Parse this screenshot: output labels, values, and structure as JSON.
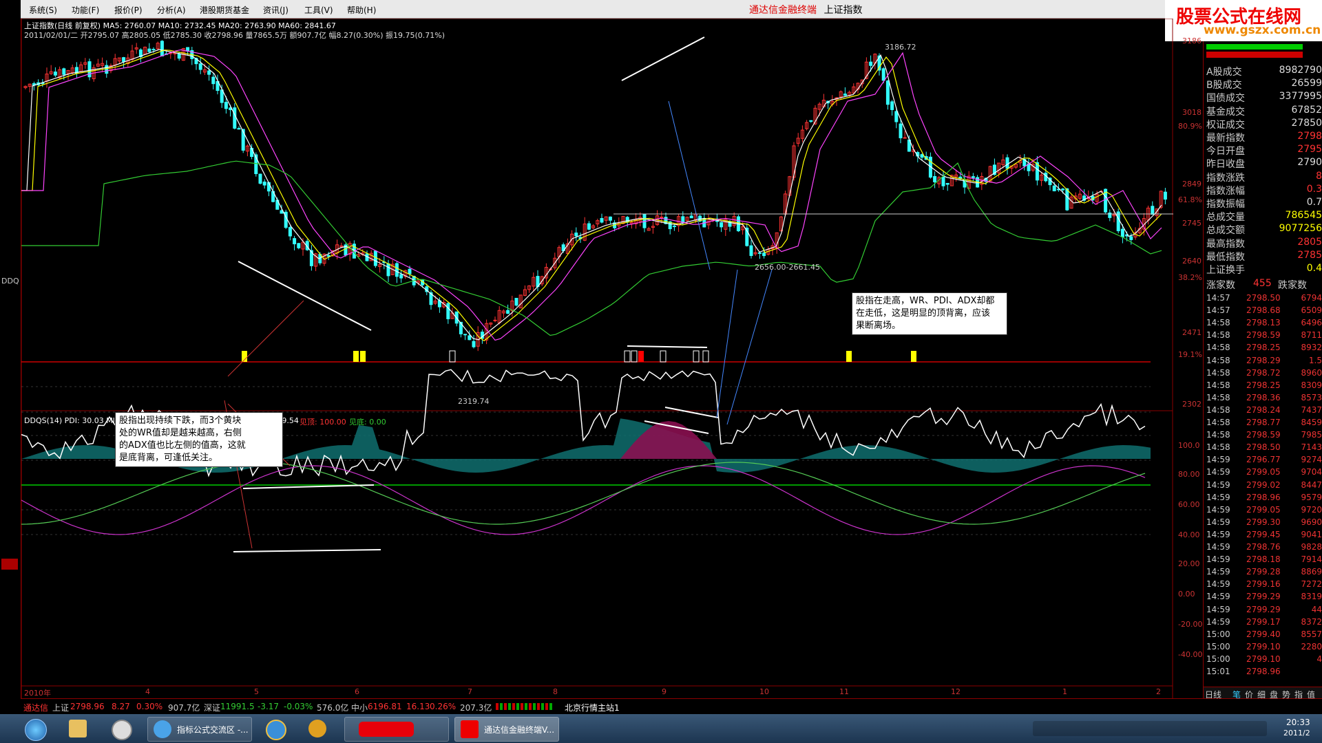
{
  "menu": {
    "items": [
      "系统(S)",
      "功能(F)",
      "报价(P)",
      "分析(A)",
      "港股期货基金",
      "资讯(J)",
      "工具(V)",
      "帮助(H)"
    ],
    "app_title": "通达信金融终端",
    "instrument": "上证指数"
  },
  "watermark": {
    "title": "股票公式在线网",
    "url": "www.gszx.com.cn"
  },
  "chart": {
    "info_line1": "上证指数(日线 前复权) MA5: 2760.07 MA10: 2732.45 MA20: 2763.90 MA60: 2841.67",
    "info_line2": "2011/02/01/二 开2795.07 高2805.05 低2785.30 收2798.96 量7865.5万 额907.7亿 幅8.27(0.30%) 振19.75(0.71%)",
    "price_labels": {
      "high": "3186.72",
      "low": "2319.74",
      "mid": "2656.00-2661.45"
    },
    "price_axis": [
      "3186",
      "3018",
      "2849",
      "2745",
      "2640",
      "2471",
      "2302"
    ],
    "price_pct": [
      "80.9%",
      "61.8%",
      "38.2%",
      "19.1%"
    ],
    "indicator_header": "DDQS(14) PDI: 30.03 MI...",
    "indicator_tail": "WR: 49.54",
    "indicator_signal_1": "见顶: 100.00",
    "indicator_signal_2": "见底: 0.00",
    "indicator_axis": [
      "100.0",
      "80.00",
      "60.00",
      "40.00",
      "20.00",
      "0.00",
      "-20.00",
      "-40.00"
    ],
    "indicator_left_label": "DDQ"
  },
  "annotations": {
    "left_note": [
      "股指出现持续下跌，而3个黄块",
      "处的WR值却是越来越高，右侧",
      "的ADX值也比左侧的值高，这就",
      "是底背离，可逢低关注。"
    ],
    "right_note": [
      "股指在走高，WR、PDI、ADX却都",
      "在走低，这是明显的顶背离，应该",
      "果断离场。"
    ]
  },
  "date_axis": [
    "2010年",
    "4",
    "5",
    "6",
    "7",
    "8",
    "9",
    "10",
    "11",
    "12",
    "1",
    "2"
  ],
  "right_panel": {
    "stats": [
      {
        "label": "A股成交",
        "value": "8982790",
        "color": "#dddddd"
      },
      {
        "label": "B股成交",
        "value": "26599",
        "color": "#dddddd"
      },
      {
        "label": "国债成交",
        "value": "3377995",
        "color": "#dddddd"
      },
      {
        "label": "基金成交",
        "value": "67852",
        "color": "#dddddd"
      },
      {
        "label": "权证成交",
        "value": "27850",
        "color": "#dddddd"
      },
      {
        "label": "最新指数",
        "value": "2798",
        "color": "#ff3333"
      },
      {
        "label": "今日开盘",
        "value": "2795",
        "color": "#ff3333"
      },
      {
        "label": "昨日收盘",
        "value": "2790",
        "color": "#dddddd"
      },
      {
        "label": "指数涨跌",
        "value": "8",
        "color": "#ff3333"
      },
      {
        "label": "指数涨幅",
        "value": "0.3",
        "color": "#ff3333"
      },
      {
        "label": "指数振幅",
        "value": "0.7",
        "color": "#dddddd"
      },
      {
        "label": "总成交量",
        "value": "786545",
        "color": "#ffff00"
      },
      {
        "label": "总成交额",
        "value": "9077256",
        "color": "#ffff00"
      },
      {
        "label": "最高指数",
        "value": "2805",
        "color": "#ff3333"
      },
      {
        "label": "最低指数",
        "value": "2785",
        "color": "#ff3333"
      },
      {
        "label": "上证换手",
        "value": "0.4",
        "color": "#ffff00"
      }
    ],
    "adv_label": "涨家数",
    "adv_value": "455",
    "dec_label": "跌家数",
    "ticks": [
      {
        "t": "14:57",
        "p": "2798.50",
        "v": "6794"
      },
      {
        "t": "14:57",
        "p": "2798.68",
        "v": "6509"
      },
      {
        "t": "14:58",
        "p": "2798.13",
        "v": "6496"
      },
      {
        "t": "14:58",
        "p": "2798.59",
        "v": "8711"
      },
      {
        "t": "14:58",
        "p": "2798.25",
        "v": "8932"
      },
      {
        "t": "14:58",
        "p": "2798.29",
        "v": "1.5"
      },
      {
        "t": "14:58",
        "p": "2798.72",
        "v": "8960"
      },
      {
        "t": "14:58",
        "p": "2798.25",
        "v": "8309"
      },
      {
        "t": "14:58",
        "p": "2798.36",
        "v": "8573"
      },
      {
        "t": "14:58",
        "p": "2798.24",
        "v": "7437"
      },
      {
        "t": "14:58",
        "p": "2798.77",
        "v": "8459"
      },
      {
        "t": "14:58",
        "p": "2798.59",
        "v": "7985"
      },
      {
        "t": "14:58",
        "p": "2798.50",
        "v": "7143"
      },
      {
        "t": "14:59",
        "p": "2796.77",
        "v": "9274"
      },
      {
        "t": "14:59",
        "p": "2799.05",
        "v": "9704"
      },
      {
        "t": "14:59",
        "p": "2799.02",
        "v": "8447"
      },
      {
        "t": "14:59",
        "p": "2798.96",
        "v": "9579"
      },
      {
        "t": "14:59",
        "p": "2799.05",
        "v": "9720"
      },
      {
        "t": "14:59",
        "p": "2799.30",
        "v": "9690"
      },
      {
        "t": "14:59",
        "p": "2799.45",
        "v": "9041"
      },
      {
        "t": "14:59",
        "p": "2798.76",
        "v": "9828"
      },
      {
        "t": "14:59",
        "p": "2798.18",
        "v": "7914"
      },
      {
        "t": "14:59",
        "p": "2799.28",
        "v": "8869"
      },
      {
        "t": "14:59",
        "p": "2799.16",
        "v": "7272"
      },
      {
        "t": "14:59",
        "p": "2799.29",
        "v": "8319"
      },
      {
        "t": "14:59",
        "p": "2799.29",
        "v": "44"
      },
      {
        "t": "14:59",
        "p": "2799.17",
        "v": "8372"
      },
      {
        "t": "15:00",
        "p": "2799.40",
        "v": "8557"
      },
      {
        "t": "15:00",
        "p": "2799.10",
        "v": "2280"
      },
      {
        "t": "15:00",
        "p": "2799.10",
        "v": "4"
      },
      {
        "t": "15:01",
        "p": "2798.96",
        "v": ""
      }
    ],
    "tabs": [
      "日线",
      "笔",
      "价",
      "细",
      "盘",
      "势",
      "指",
      "值"
    ]
  },
  "statusbar": {
    "brand": "通达信",
    "sh_label": "上证",
    "sh_value": "2798.96",
    "sh_change": "8.27",
    "sh_pct": "0.30%",
    "sh_amount": "907.7亿",
    "sz_label": "深证",
    "sz_value": "11991.5",
    "sz_change": "-3.17",
    "sz_pct": "-0.03%",
    "sz_amount": "576.0亿",
    "zx_label": "中小",
    "zx_value": "6196.81",
    "zx_change": "16.13",
    "zx_pct": "0.26%",
    "zx_amount": "207.3亿",
    "server": "北京行情主站1"
  },
  "taskbar": {
    "buttons": [
      "指标公式交流区 -...",
      "通达信金融终端V..."
    ],
    "clock": "20:33",
    "clock_date": "2011/2"
  },
  "colors": {
    "up": "#ff3333",
    "down": "#33ffff",
    "ma5": "#ffffff",
    "ma10": "#ffff00",
    "ma20": "#ff44ff",
    "ma60": "#33cc33",
    "frame": "#8b0000"
  }
}
